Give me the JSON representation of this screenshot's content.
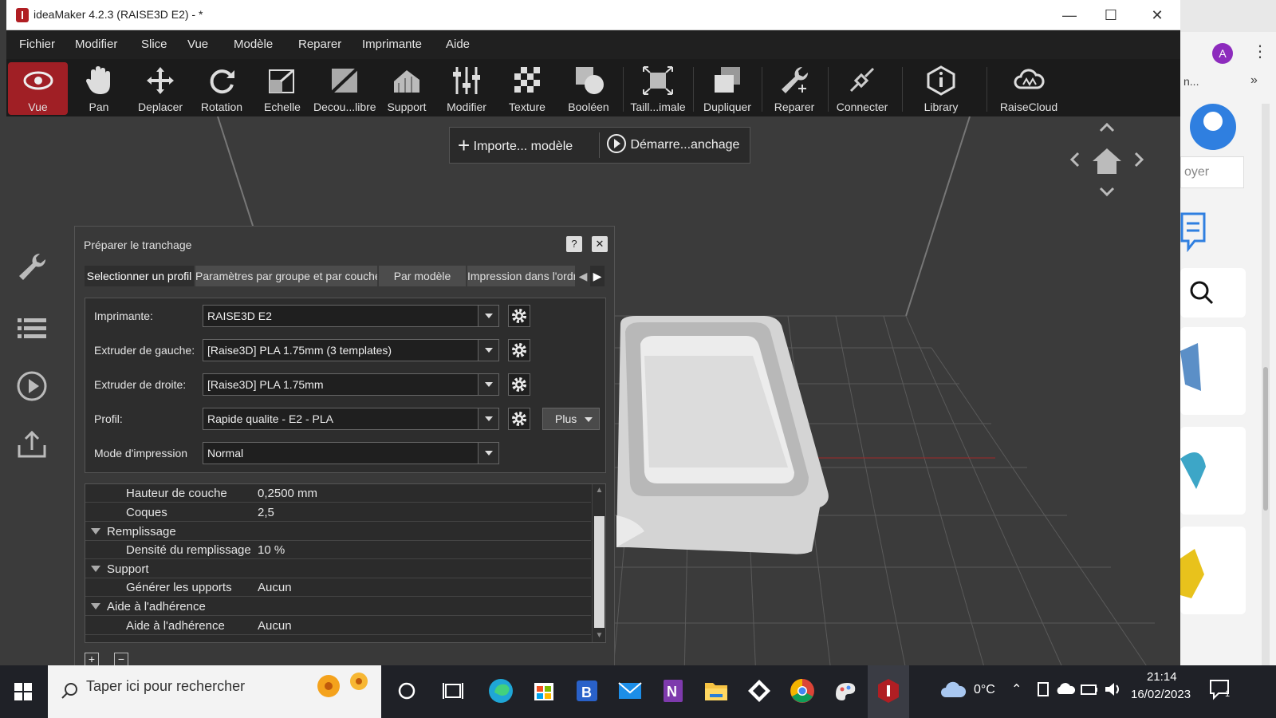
{
  "window": {
    "title": "ideaMaker 4.2.3 (RAISE3D E2) - *",
    "minimize": "—",
    "maximize": "☐",
    "close": "✕"
  },
  "menu": [
    "Fichier",
    "Modifier",
    "Slice",
    "Vue",
    "Modèle",
    "Reparer",
    "Imprimante",
    "Aide"
  ],
  "toolbar": [
    {
      "label": "Vue",
      "icon": "eye-icon"
    },
    {
      "label": "Pan",
      "icon": "hand-icon"
    },
    {
      "label": "Deplacer",
      "icon": "move-icon"
    },
    {
      "label": "Rotation",
      "icon": "rotate-icon"
    },
    {
      "label": "Echelle",
      "icon": "scale-icon"
    },
    {
      "label": "Decou...libre",
      "icon": "cut-icon"
    },
    {
      "label": "Support",
      "icon": "support-icon"
    },
    {
      "label": "Modifier",
      "icon": "sliders-icon"
    },
    {
      "label": "Texture",
      "icon": "texture-icon"
    },
    {
      "label": "Booléen",
      "icon": "boolean-icon"
    },
    {
      "label": "Taill...imale",
      "icon": "maxsize-icon"
    },
    {
      "label": "Dupliquer",
      "icon": "duplicate-icon"
    },
    {
      "label": "Reparer",
      "icon": "wrench-icon"
    },
    {
      "label": "Connecter",
      "icon": "connect-icon"
    },
    {
      "label": "Library",
      "icon": "library-icon"
    },
    {
      "label": "RaiseCloud",
      "icon": "cloud-icon"
    }
  ],
  "actions": {
    "import_label": "Importe... modèle",
    "start_label": "Démarre...anchage"
  },
  "dialog": {
    "title": "Préparer le tranchage",
    "help": "?",
    "close": "✕",
    "tabs": [
      "Selectionner un profil",
      "Paramètres par groupe et par couche",
      "Par modèle",
      "Impression dans l'ordre"
    ],
    "fields": {
      "printer": {
        "label": "Imprimante:",
        "value": "RAISE3D E2"
      },
      "left_extruder": {
        "label": "Extruder de gauche:",
        "value": "[Raise3D] PLA 1.75mm (3 templates)"
      },
      "right_extruder": {
        "label": "Extruder de droite:",
        "value": "[Raise3D] PLA 1.75mm"
      },
      "profile": {
        "label": "Profil:",
        "value": "Rapide qualite - E2 - PLA"
      },
      "mode": {
        "label": "Mode d'impression",
        "value": "Normal"
      }
    },
    "more_label": "Plus",
    "params": [
      {
        "type": "item",
        "name": "Hauteur de couche",
        "value": "0,2500 mm"
      },
      {
        "type": "item",
        "name": "Coques",
        "value": "2,5"
      },
      {
        "type": "group",
        "name": "Remplissage"
      },
      {
        "type": "item",
        "name": "Densité du remplissage",
        "value": "10 %"
      },
      {
        "type": "group",
        "name": "Support"
      },
      {
        "type": "item",
        "name": "Générer les upports",
        "value": "Aucun"
      },
      {
        "type": "group",
        "name": "Aide à l'adhérence"
      },
      {
        "type": "item",
        "name": "Aide à l'adhérence",
        "value": "Aucun"
      }
    ],
    "add": "+",
    "remove": "−"
  },
  "browser_bg": {
    "avatar": "A",
    "menu_dots": "⋮",
    "chevron": "»",
    "partial_text": "n...",
    "envoyer": "oyer"
  },
  "taskbar": {
    "search_placeholder": "Taper ici pour rechercher",
    "temperature": "0°C",
    "time": "21:14",
    "date": "16/02/2023",
    "notifications": "1"
  },
  "colors": {
    "accent": "#a01f25",
    "toolbar_bg": "#1b1b1b",
    "viewport_bg": "#3b3b3b",
    "grid": "#5a5a5a"
  }
}
